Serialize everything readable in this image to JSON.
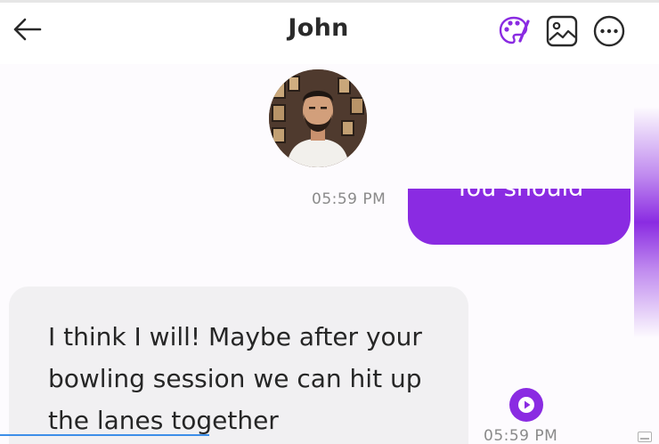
{
  "header": {
    "title": "John"
  },
  "messages": [
    {
      "direction": "outgoing",
      "text": "You should",
      "time": "05:59 PM"
    },
    {
      "direction": "incoming",
      "text": "I think I will! Maybe after your bowling session we can hit up the lanes together",
      "time": "05:59 PM"
    }
  ],
  "icons": {
    "back": "arrow-left-icon",
    "palette": "palette-icon",
    "gallery": "image-icon",
    "more": "more-horizontal-icon",
    "play": "play-icon"
  },
  "colors": {
    "accent": "#8a2be2",
    "incoming_bubble": "#f1f0f2",
    "background": "#fdfbfe"
  }
}
